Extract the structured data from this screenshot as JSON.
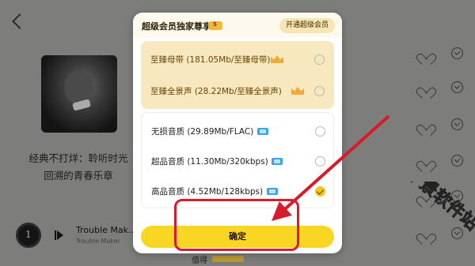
{
  "background": {
    "album_title_line1": "经典不打烊：聆听时光",
    "album_title_line2": "回溯的青春乐章",
    "player": {
      "cover_glyph": "1",
      "title": "Trouble Mak...",
      "artist": "Trouble Maker"
    },
    "bottom_peek_text": "值得"
  },
  "modal": {
    "header_title": "超级会员独家尊享",
    "header_badge": "5",
    "open_vip_label": "开通超级会员",
    "vip_options": [
      {
        "label": "至臻母带  (181.05Mb/至臻母带)",
        "badge": "5",
        "selected": false
      },
      {
        "label": "至臻全景声  (28.22Mb/至臻全景声)",
        "badge": "5",
        "selected": false
      }
    ],
    "options": [
      {
        "label": "无损音质  (29.89Mb/FLAC)",
        "selected": false
      },
      {
        "label": "超品音质  (11.30Mb/320kbps)",
        "selected": false
      },
      {
        "label": "高品音质  (4.52Mb/128kbps)",
        "selected": true
      }
    ],
    "confirm_label": "确定"
  },
  "watermark_text": "千景软件站",
  "colors": {
    "accent_yellow": "#f9d623",
    "vip_gold_bg": "#f8e8c0",
    "annotation_red": "#d91a2a",
    "hq_icon_blue": "#3da2ee"
  }
}
